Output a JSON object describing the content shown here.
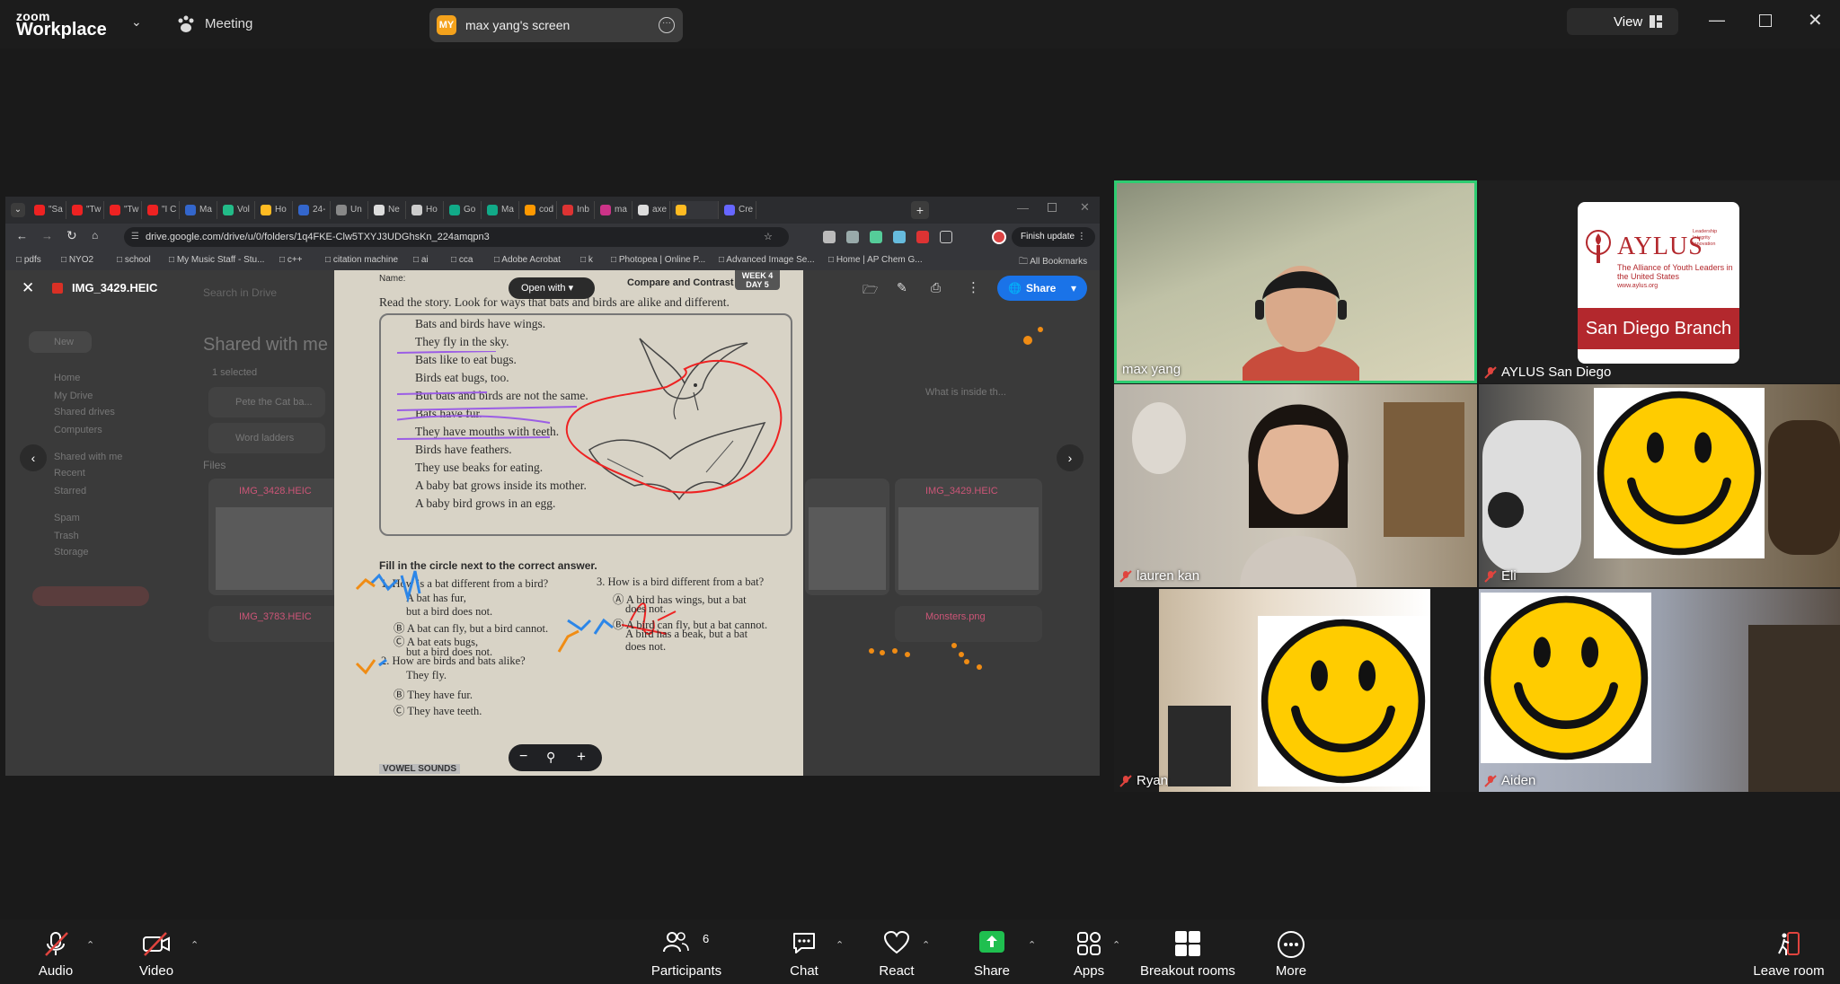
{
  "zoom": {
    "logo_top": "zoom",
    "logo_bottom": "Workplace",
    "meeting_label": "Meeting",
    "screen_badge": "MY",
    "screen_title": "max yang's screen",
    "view_label": "View"
  },
  "browser": {
    "tabs": [
      "\"Sa",
      "\"Tw",
      "\"Tw",
      "\"I C",
      "Ma",
      "Vol",
      "Ho",
      "24-",
      "Un",
      "Ne",
      "Ho",
      "Go",
      "Ma",
      "cod",
      "Inb",
      "ma",
      "axe",
      "",
      "Cre"
    ],
    "url": "drive.google.com/drive/u/0/folders/1q4FKE-Clw5TXYJ3UDGhsKn_224amqpn3",
    "finish_update": "Finish update",
    "bookmarks": [
      "pdfs",
      "NYO2",
      "school",
      "My Music Staff - Stu...",
      "c++",
      "citation machine",
      "ai",
      "cca",
      "Adobe Acrobat",
      "k",
      "Photopea | Online P...",
      "Advanced Image Se...",
      "Home | AP Chem G..."
    ],
    "all_bookmarks": "All Bookmarks"
  },
  "viewer": {
    "filename": "IMG_3429.HEIC",
    "open_with": "Open with",
    "share": "Share",
    "search_placeholder": "Search in Drive",
    "background_title": "Shared with me",
    "background_side": [
      "New",
      "Home",
      "My Drive",
      "Shared drives",
      "Computers",
      "Shared with me",
      "Recent",
      "Starred",
      "Spam",
      "Trash",
      "Storage"
    ],
    "background_files": [
      "Pete the Cat ba...",
      "Word ladders",
      "IMG_3428.HEIC",
      "IMG_3429.HEIC",
      "IMG_3783.HEIC",
      "Monsters.png",
      "What is inside th..."
    ],
    "folders_label": "Files",
    "selected_label": "1 selected"
  },
  "worksheet": {
    "name_label": "Name:",
    "header": "Compare and Contrast",
    "week": "WEEK 4",
    "day": "DAY 5",
    "instruction": "Read the story. Look for ways that bats and birds are alike and different.",
    "story": [
      "Bats and birds have wings.",
      "They fly in the sky.",
      "Bats like to eat bugs.",
      "Birds eat bugs, too.",
      "But bats and birds are not the same.",
      "Bats have fur.",
      "They have mouths with teeth.",
      "Birds have feathers.",
      "They use beaks for eating.",
      "A baby bat grows inside its mother.",
      "A baby bird grows in an egg."
    ],
    "fill_instruction": "Fill in the circle next to the correct answer.",
    "q1": "1. How is a bat different from a bird?",
    "q1_answers": [
      "A bat has fur,",
      "but a bird does not.",
      "Ⓑ A bat can fly, but a bird cannot.",
      "Ⓒ A bat eats bugs,",
      "but a bird does not."
    ],
    "q2": "2. How are birds and bats alike?",
    "q2_answers": [
      "They fly.",
      "Ⓑ They have fur.",
      "Ⓒ They have teeth."
    ],
    "q3": "3. How is a bird different from a bat?",
    "q3_answers": [
      "Ⓐ A bird has wings, but a bat",
      "does not.",
      "Ⓑ A bird can fly, but a bat cannot.",
      "A bird has a beak, but a bat",
      "does not."
    ],
    "footer": "VOWEL SOUNDS"
  },
  "participants": [
    {
      "name": "max yang",
      "muted": false
    },
    {
      "name": "AYLUS San Diego",
      "muted": true,
      "logo_title": "AYLUS",
      "logo_sub": "The Alliance of Youth Leaders in the United States",
      "logo_url": "www.aylus.org",
      "logo_side": "Leadership Integrity Innovation",
      "logo_branch": "San Diego Branch"
    },
    {
      "name": "lauren kan",
      "muted": true
    },
    {
      "name": "Eli",
      "muted": true
    },
    {
      "name": "Ryan",
      "muted": true
    },
    {
      "name": "Aiden",
      "muted": true
    }
  ],
  "toolbar": {
    "audio": "Audio",
    "video": "Video",
    "participants": "Participants",
    "participants_count": "6",
    "chat": "Chat",
    "react": "React",
    "share": "Share",
    "apps": "Apps",
    "breakout": "Breakout rooms",
    "more": "More",
    "leave": "Leave room"
  },
  "colors": {
    "active_speaker": "#2ecc71",
    "share_green": "#1fbf4f",
    "mute_red": "#e0443e"
  }
}
